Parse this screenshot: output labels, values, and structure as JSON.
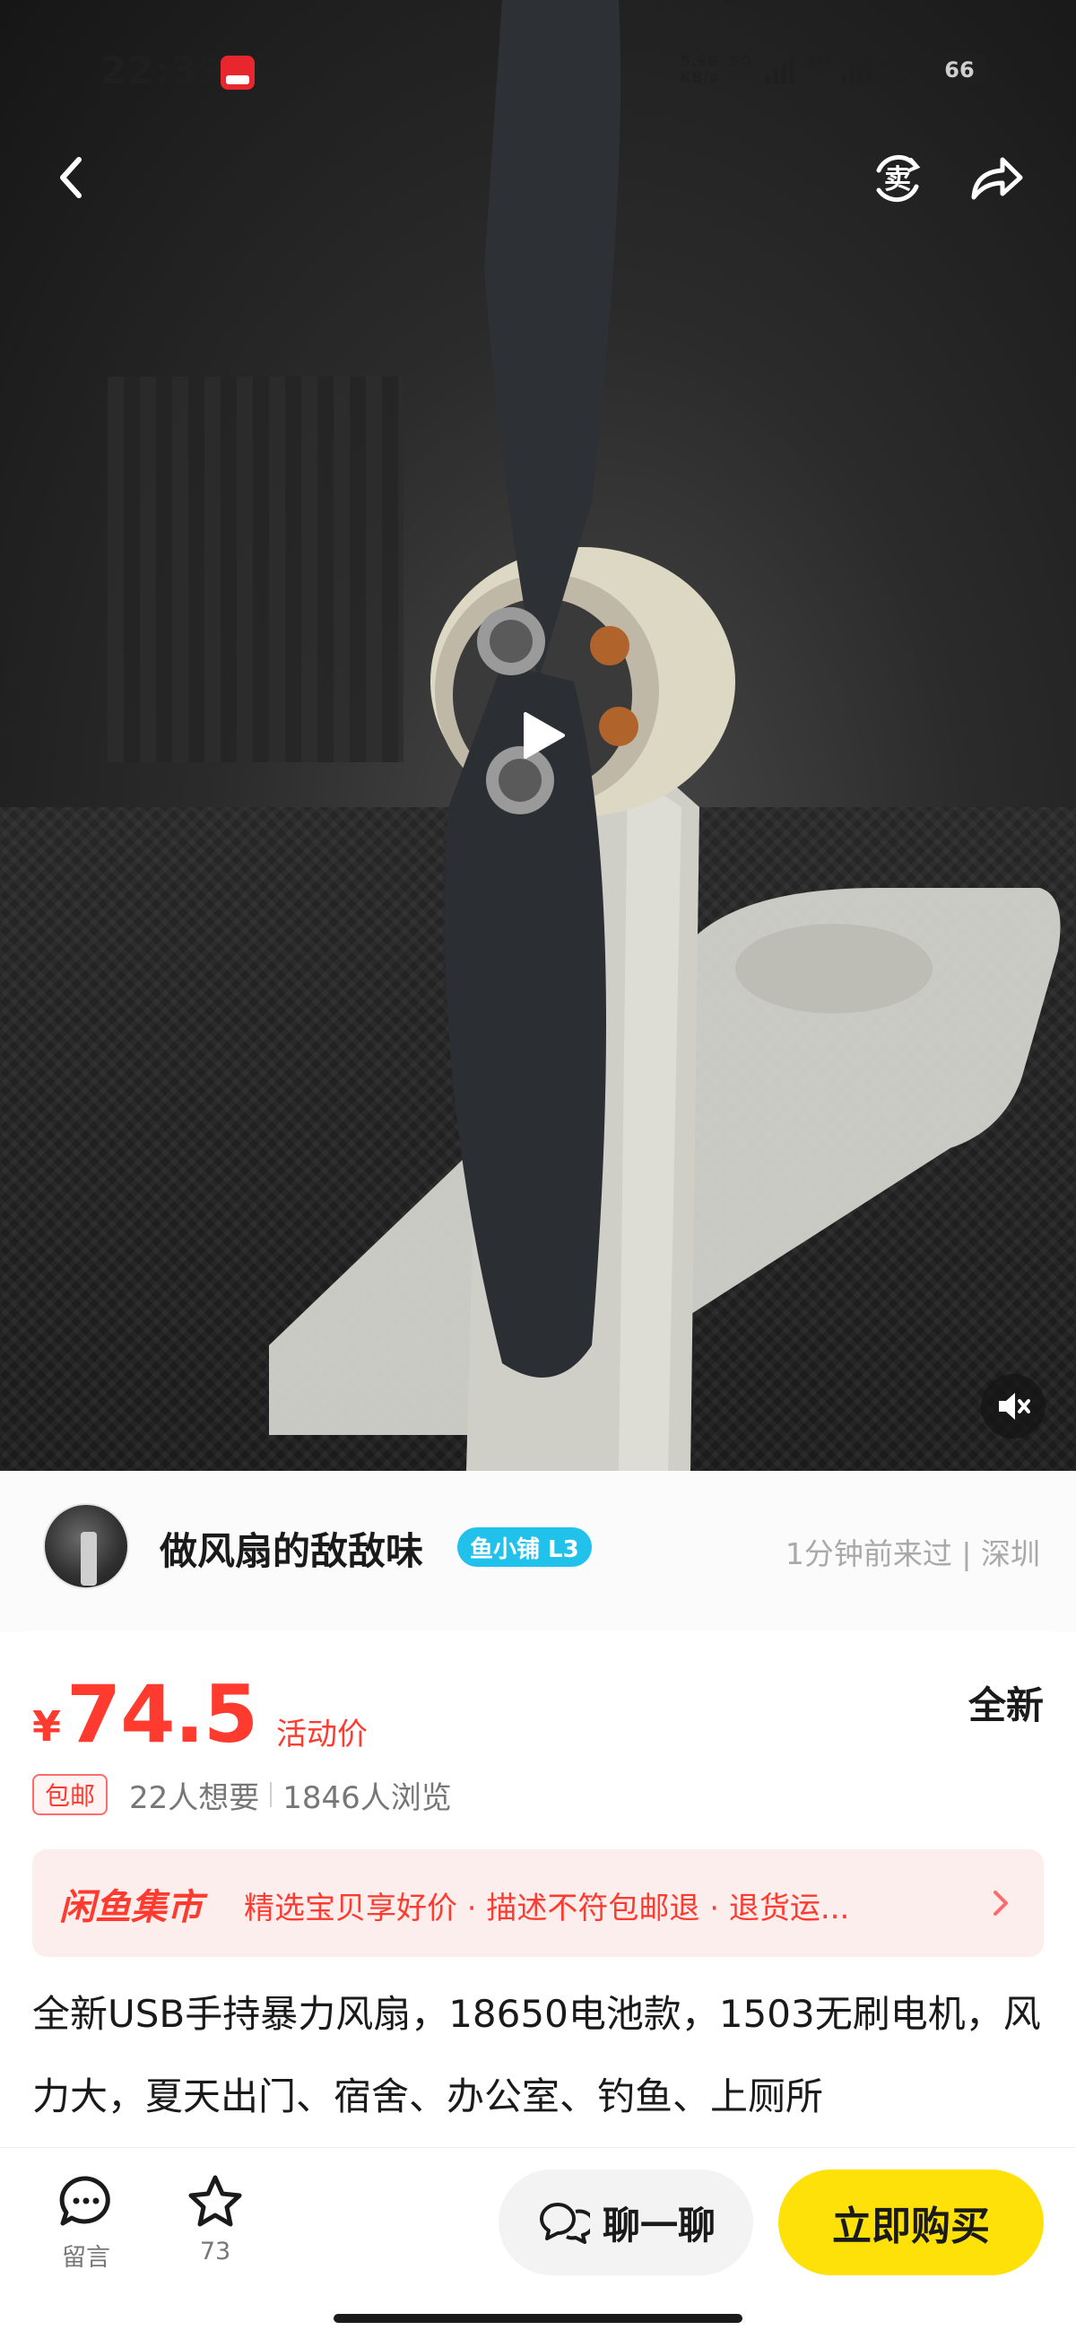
{
  "status_bar": {
    "time": "22:39",
    "net_speed": "5.96",
    "net_unit": "KB/s",
    "network_1": "5G",
    "network_2": "5G",
    "battery": "66"
  },
  "nav": {
    "back_icon": "chevron-left-icon",
    "sell_icon": "sell-icon",
    "sell_label": "卖",
    "share_icon": "share-icon"
  },
  "video": {
    "play_icon": "play-icon",
    "mute_icon": "mute-icon"
  },
  "seller": {
    "name": "做风扇的敌敌味",
    "badge": "鱼小铺 L3",
    "meta": "1分钟前来过 | 深圳"
  },
  "product": {
    "currency": "¥",
    "price": "74.5",
    "price_tag": "活动价",
    "condition": "全新",
    "shipping": "包邮",
    "wants": "22人想要",
    "views": "1846人浏览",
    "market_brand": "闲鱼集市",
    "market_text": "精选宝贝享好价 · 描述不符包邮退 · 退货运...",
    "description": "全新USB手持暴力风扇，18650电池款，1503无刷电机，风力大，夏天出门、宿舍、办公室、钓鱼、上厕所"
  },
  "bottom_bar": {
    "comment_label": "留言",
    "favorite_count": "73",
    "chat_label": "聊一聊",
    "buy_label": "立即购买"
  },
  "colors": {
    "accent_red": "#ff3b30",
    "buy_yellow": "#ffe10a",
    "badge_cyan": "#20c1ea"
  }
}
